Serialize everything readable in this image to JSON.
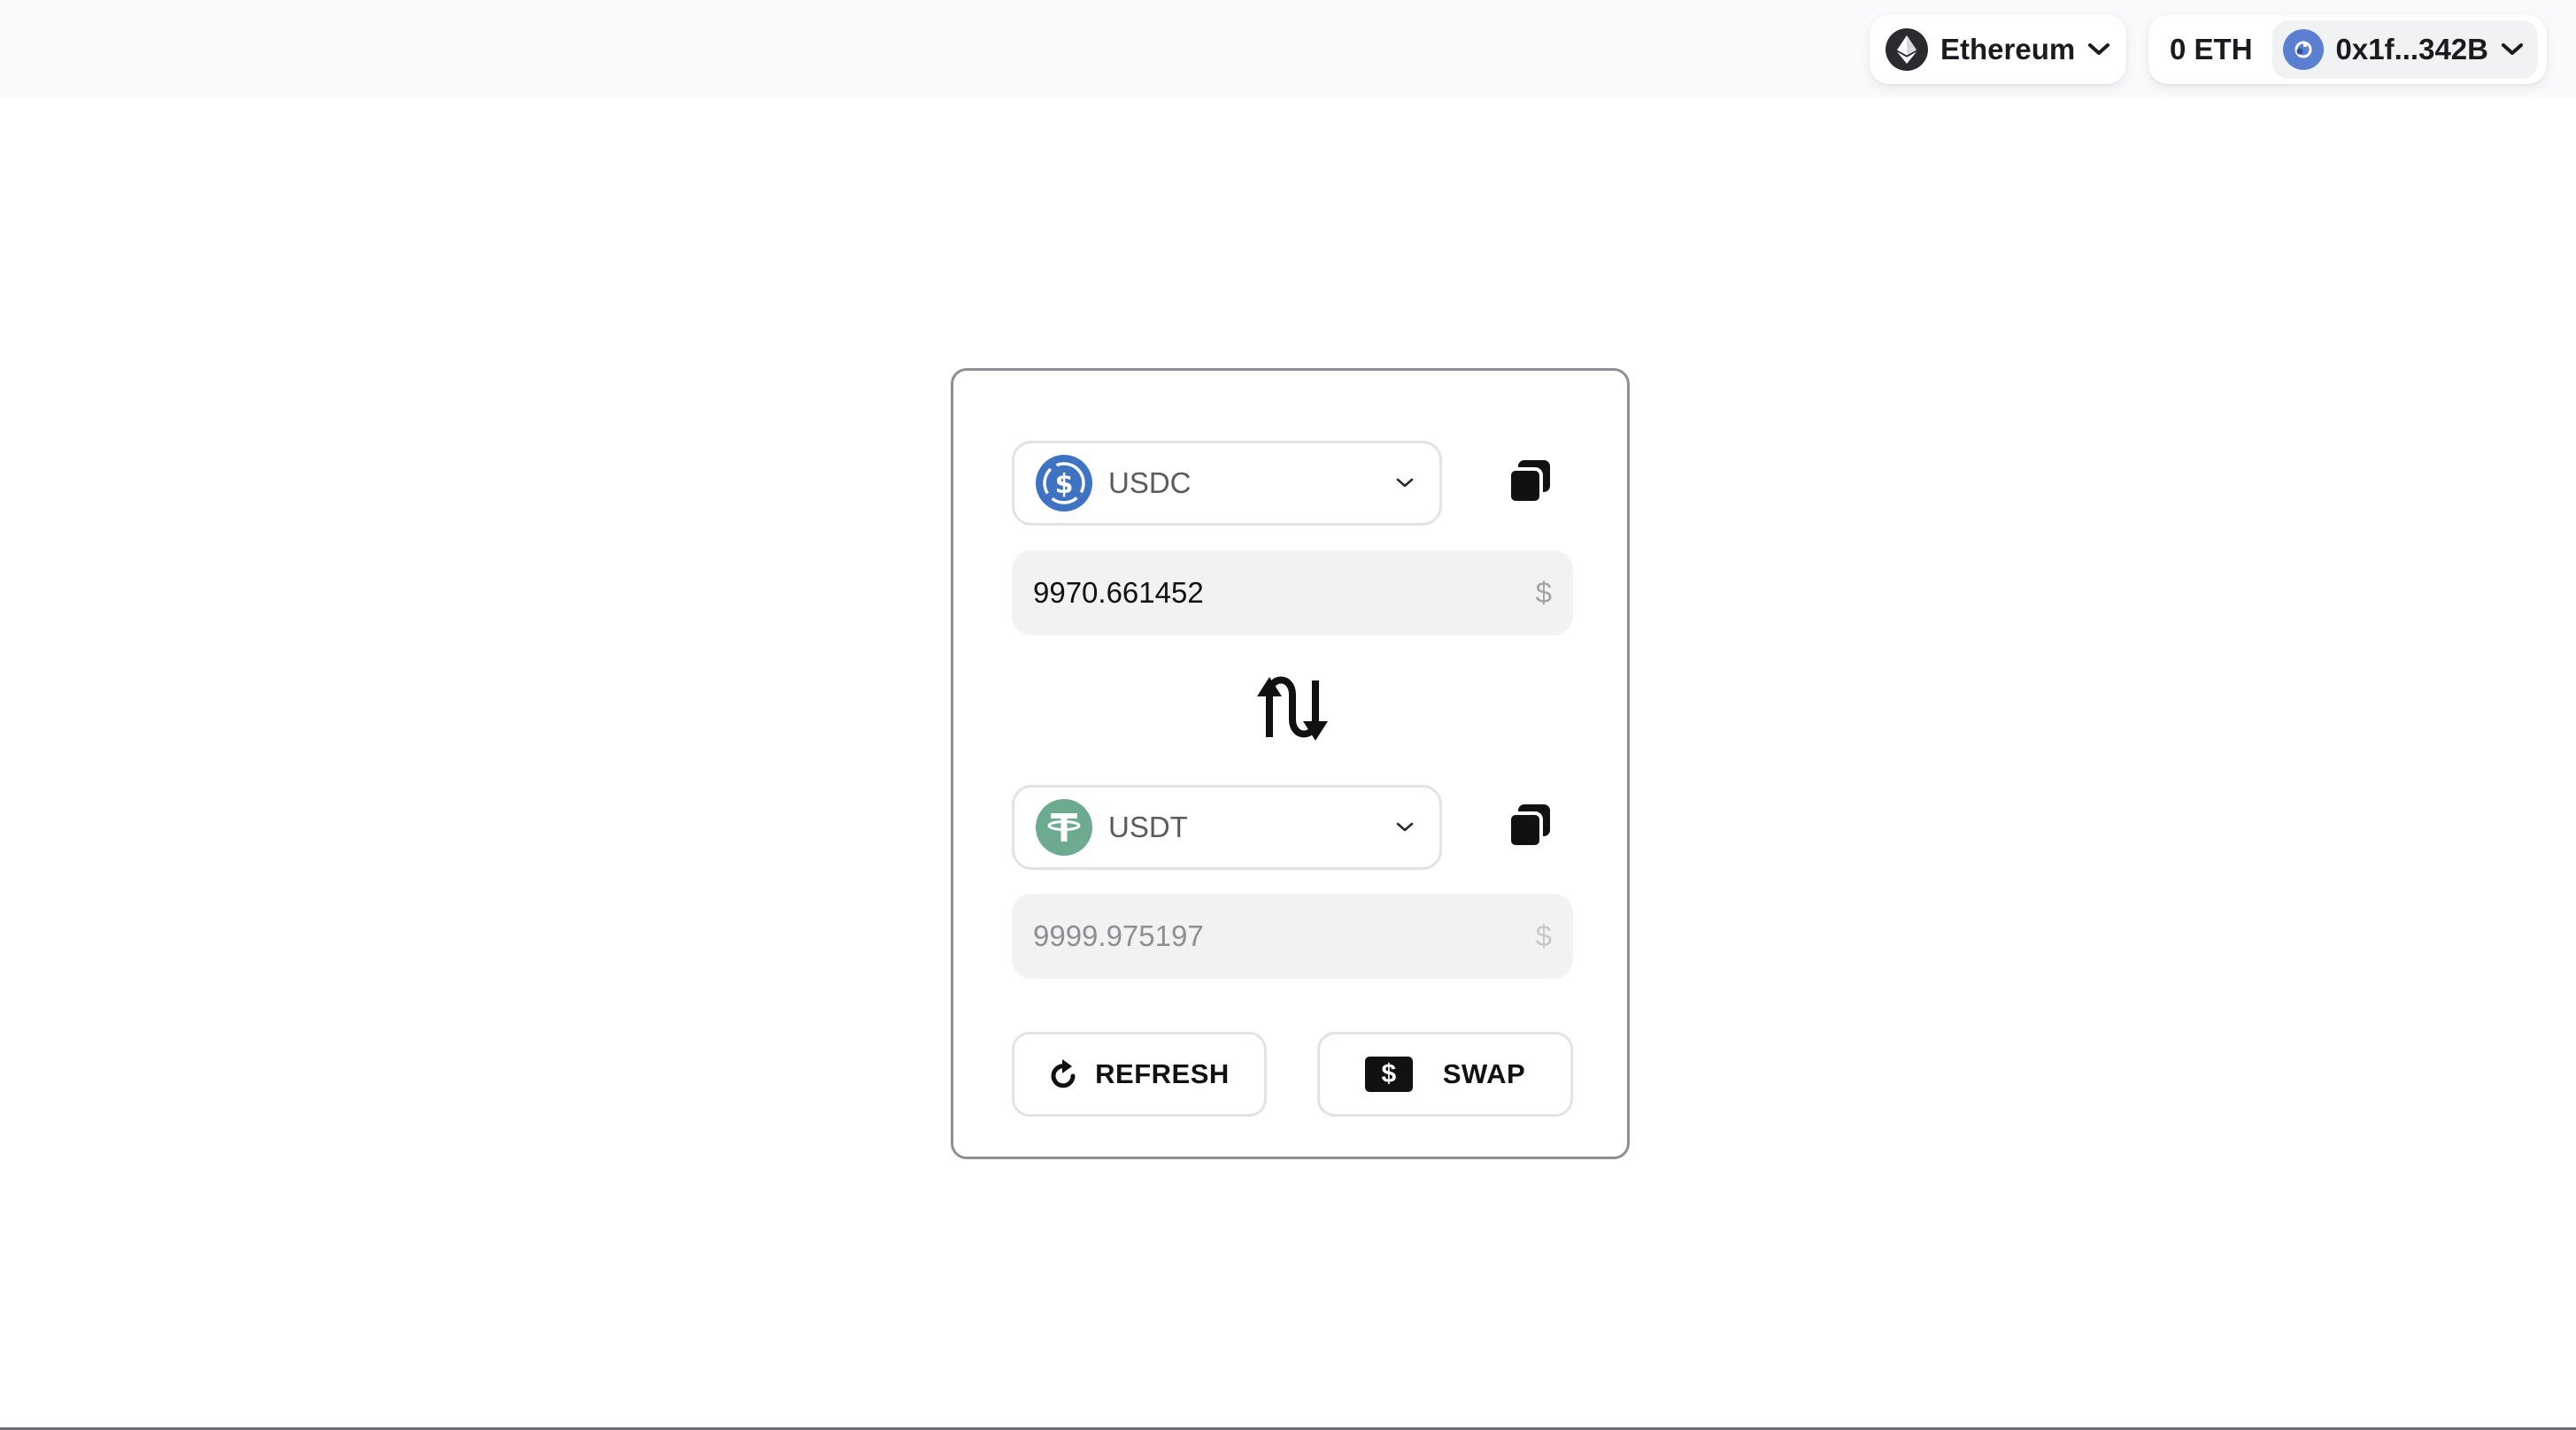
{
  "header": {
    "network": {
      "label": "Ethereum",
      "icon": "ethereum-icon"
    },
    "balance": "0 ETH",
    "account": {
      "address": "0x1f...342B",
      "icon": "avatar-icon"
    }
  },
  "swap": {
    "from": {
      "token": "USDC",
      "token_color": "#3e73c4",
      "amount": "9970.661452",
      "currency_symbol": "$"
    },
    "to": {
      "token": "USDT",
      "token_color": "#6cab8f",
      "amount": "9999.975197",
      "currency_symbol": "$"
    },
    "switch_icon": "swap-direction-icon",
    "copy_icon": "copy-icon",
    "refresh_label": "REFRESH",
    "swap_label": "SWAP",
    "swap_icon_glyph": "$"
  }
}
